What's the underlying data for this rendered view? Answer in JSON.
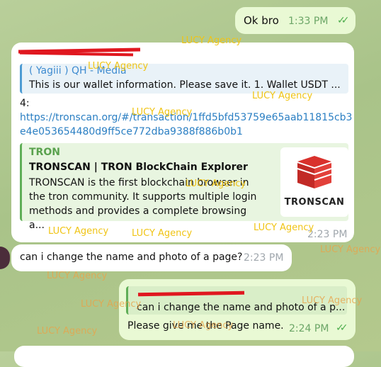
{
  "messages": {
    "m1": {
      "text": "Ok bro",
      "time": "1:33 PM",
      "status": "read"
    },
    "m2": {
      "reply_name": "( Yagiii ) QH - Media",
      "reply_text": "This is our wallet information. Please save it.   1. Wallet USDT ...",
      "text_prefix": "4:",
      "link": "https://tronscan.org/#/transaction/1ffd5bfd53759e65aab11815cb3e4e053654480d9ff5ce772dba9388f886b0b1",
      "preview": {
        "site": "TRON",
        "title": "TRONSCAN | TRON BlockChain Explorer",
        "description": "TRONSCAN is the first blockchain browser in the tron community. It supports multiple login methods and provides a complete browsing a...",
        "thumb_label": "TRONSCAN"
      },
      "time": "2:23 PM"
    },
    "m3": {
      "text": "can i change the name and photo of a page?",
      "time": "2:23 PM"
    },
    "m4": {
      "reply_text": "can i change the name and photo of a p...",
      "text": "Please give me the Page name.",
      "time": "2:24 PM",
      "status": "read"
    }
  },
  "watermark": "LUCY Agency",
  "colors": {
    "outgoing_bubble": "#e9f9d4",
    "incoming_bubble": "#ffffff",
    "link": "#2b7fc3",
    "redaction": "#e0171f"
  }
}
